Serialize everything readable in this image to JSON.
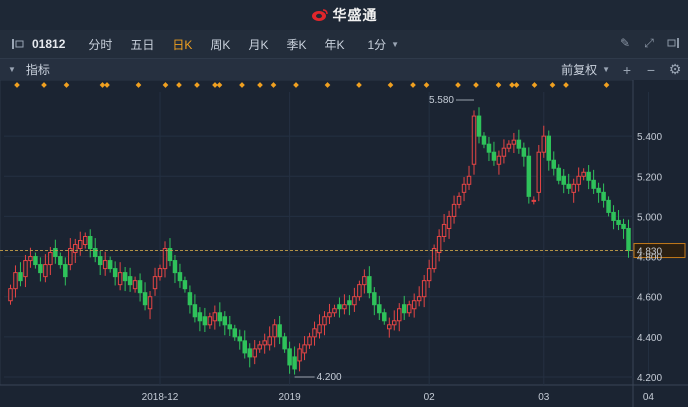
{
  "app": {
    "name": "华盛通"
  },
  "toolbar": {
    "code": "01812",
    "tabs": [
      "分时",
      "五日",
      "日K",
      "周K",
      "月K",
      "季K",
      "年K"
    ],
    "active_tab": "日K",
    "interval": "1分"
  },
  "indicator_bar": {
    "label": "指标",
    "adjust": "前复权",
    "add": "+",
    "minus": "−"
  },
  "colors": {
    "up": "#e64545",
    "down": "#2fc25b",
    "accent": "#f0a020",
    "bg": "#1b2432"
  },
  "chart_data": {
    "type": "candlestick",
    "y_ticks": [
      "5.400",
      "5.200",
      "5.000",
      "4.800",
      "4.600",
      "4.400",
      "4.200"
    ],
    "y_range": [
      4.16,
      5.62
    ],
    "x_ticks": [
      "2018-12",
      "2019",
      "02",
      "03",
      "04"
    ],
    "current_price": "4.830",
    "high_label": "5.580",
    "low_label": "4.200",
    "closes": [
      4.64,
      4.72,
      4.68,
      4.78,
      4.8,
      4.76,
      4.72,
      4.76,
      4.82,
      4.8,
      4.76,
      4.7,
      4.84,
      4.86,
      4.88,
      4.9,
      4.84,
      4.8,
      4.76,
      4.78,
      4.74,
      4.7,
      4.72,
      4.68,
      4.66,
      4.68,
      4.62,
      4.56,
      4.6,
      4.7,
      4.74,
      4.84,
      4.78,
      4.72,
      4.68,
      4.64,
      4.56,
      4.5,
      4.48,
      4.46,
      4.5,
      4.52,
      4.48,
      4.46,
      4.44,
      4.4,
      4.38,
      4.32,
      4.3,
      4.34,
      4.36,
      4.38,
      4.4,
      4.46,
      4.4,
      4.34,
      4.26,
      4.24,
      4.34,
      4.36,
      4.4,
      4.44,
      4.46,
      4.5,
      4.52,
      4.54,
      4.54,
      4.56,
      4.56,
      4.6,
      4.66,
      4.7,
      4.62,
      4.56,
      4.52,
      4.48,
      4.46,
      4.48,
      4.54,
      4.52,
      4.56,
      4.58,
      4.6,
      4.68,
      4.74,
      4.84,
      4.9,
      4.96,
      5.0,
      5.06,
      5.1,
      5.16,
      5.2,
      5.5,
      5.4,
      5.36,
      5.32,
      5.28,
      5.3,
      5.34,
      5.36,
      5.38,
      5.34,
      5.3,
      5.1,
      5.08,
      5.32,
      5.4,
      5.28,
      5.24,
      5.18,
      5.16,
      5.14,
      5.16,
      5.2,
      5.22,
      5.18,
      5.14,
      5.12,
      5.08,
      5.02,
      4.98,
      4.96,
      4.94,
      4.83
    ],
    "opens": [
      4.58,
      4.64,
      4.72,
      4.7,
      4.78,
      4.8,
      4.76,
      4.7,
      4.76,
      4.84,
      4.8,
      4.76,
      4.76,
      4.82,
      4.84,
      4.86,
      4.9,
      4.84,
      4.8,
      4.74,
      4.78,
      4.74,
      4.66,
      4.72,
      4.7,
      4.64,
      4.68,
      4.62,
      4.54,
      4.64,
      4.7,
      4.74,
      4.84,
      4.78,
      4.72,
      4.68,
      4.62,
      4.56,
      4.52,
      4.5,
      4.46,
      4.48,
      4.52,
      4.5,
      4.46,
      4.44,
      4.4,
      4.38,
      4.34,
      4.3,
      4.34,
      4.36,
      4.36,
      4.4,
      4.46,
      4.4,
      4.34,
      4.3,
      4.28,
      4.32,
      4.36,
      4.4,
      4.42,
      4.46,
      4.5,
      4.52,
      4.56,
      4.54,
      4.58,
      4.56,
      4.6,
      4.66,
      4.7,
      4.62,
      4.56,
      4.52,
      4.44,
      4.46,
      4.48,
      4.56,
      4.52,
      4.54,
      4.58,
      4.6,
      4.68,
      4.74,
      4.82,
      4.9,
      4.94,
      5.0,
      5.06,
      5.12,
      5.16,
      5.26,
      5.5,
      5.4,
      5.36,
      5.32,
      5.26,
      5.3,
      5.34,
      5.36,
      5.38,
      5.34,
      5.3,
      5.08,
      5.12,
      5.32,
      5.4,
      5.28,
      5.24,
      5.2,
      5.16,
      5.12,
      5.16,
      5.2,
      5.22,
      5.18,
      5.14,
      5.12,
      5.08,
      5.02,
      4.98,
      4.96,
      4.94
    ]
  }
}
